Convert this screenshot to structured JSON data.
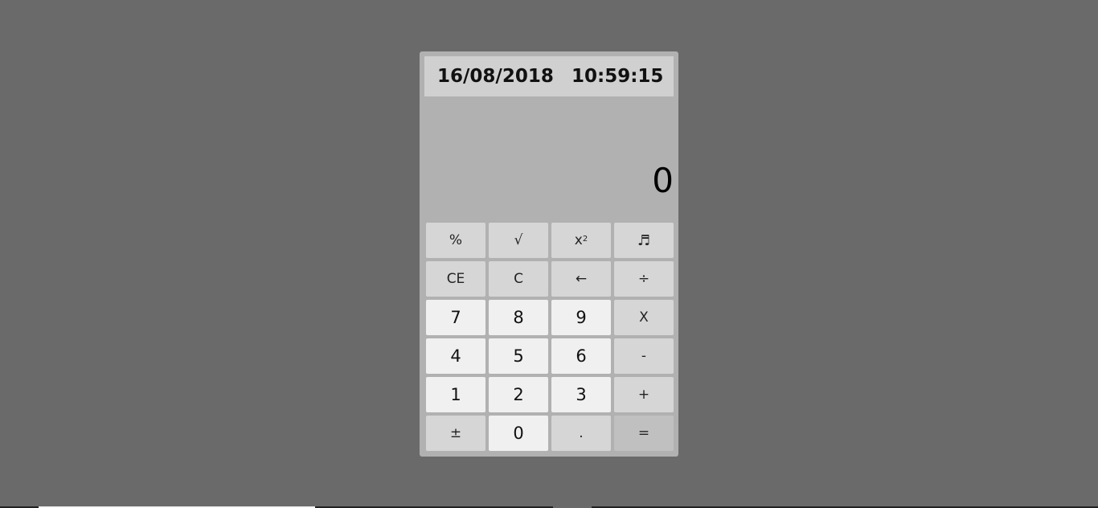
{
  "clock": {
    "date": "16/08/2018",
    "time": "10:59:15"
  },
  "display": {
    "value": "0"
  },
  "keys": {
    "percent": "%",
    "sqrt": "√",
    "square_base": "x",
    "square_exp": "2",
    "music_icon": "♬",
    "ce": "CE",
    "c": "C",
    "backspace": "←",
    "divide": "÷",
    "seven": "7",
    "eight": "8",
    "nine": "9",
    "multiply": "X",
    "four": "4",
    "five": "5",
    "six": "6",
    "minus": "-",
    "one": "1",
    "two": "2",
    "three": "3",
    "plus": "+",
    "plus_minus": "±",
    "zero": "0",
    "dot": ".",
    "equals": "="
  },
  "colors": {
    "background": "#6a6a6a",
    "calculator_body": "#b1b1b1",
    "clock_bar": "#d0d0d0",
    "number_key": "#f0f0f0",
    "function_key": "#d6d6d6",
    "equals_key": "#c0c0c0"
  }
}
